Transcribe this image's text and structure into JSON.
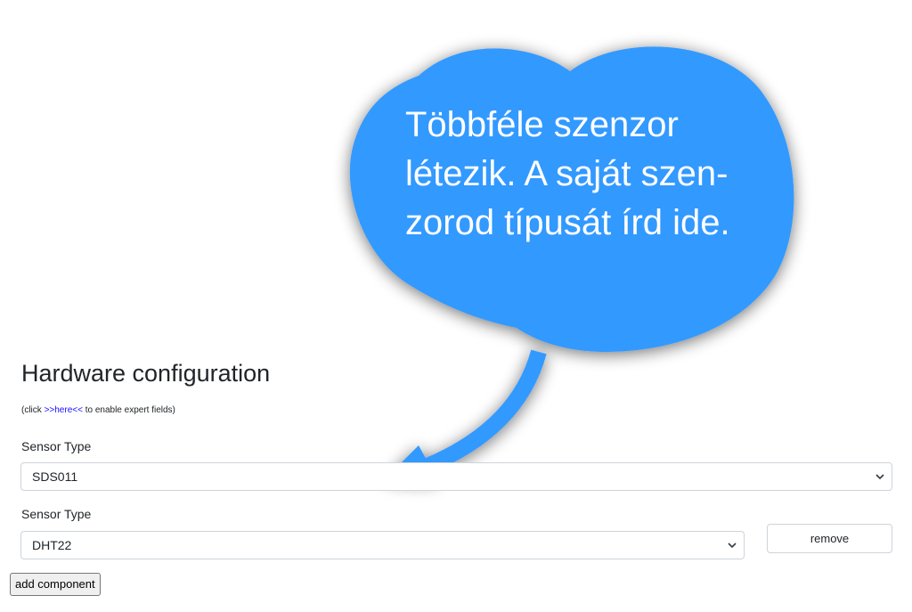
{
  "callout": {
    "lines": [
      "Többféle szenzor",
      "létezik. A saját szen-",
      "zorod típusát írd ide."
    ],
    "color": "#3399ff"
  },
  "section": {
    "title": "Hardware configuration",
    "hint_before": "(click ",
    "hint_link": ">>here<<",
    "hint_after": " to enable expert fields)"
  },
  "components": [
    {
      "label": "Sensor Type",
      "value": "SDS011"
    },
    {
      "label": "Sensor Type",
      "value": "DHT22",
      "remove_label": "remove"
    }
  ],
  "add_component_label": "add component"
}
